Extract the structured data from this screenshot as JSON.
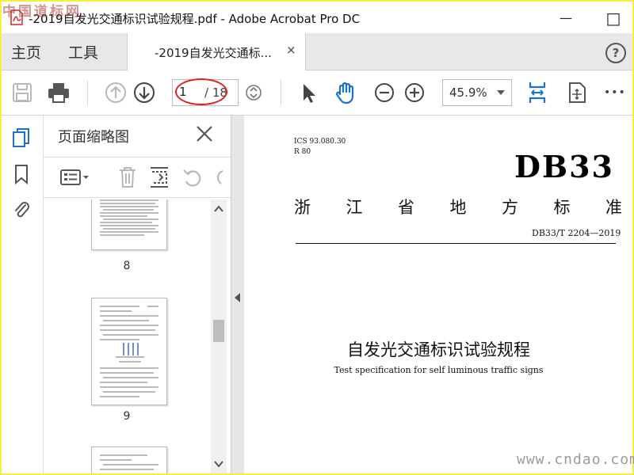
{
  "watermark": {
    "top": "中国道标网",
    "bottom": "www.cndao.com"
  },
  "window": {
    "title": "-2019自发光交通标识试验规程.pdf - Adobe Acrobat Pro DC",
    "minimize_glyph": "—",
    "maximize_glyph": "□"
  },
  "menu": {
    "home": "主页",
    "tools": "工具"
  },
  "tab": {
    "label": "-2019自发光交通标...",
    "close_glyph": "×"
  },
  "help": {
    "glyph": "?"
  },
  "toolbar": {
    "page_current": "1",
    "page_total": "/ 18",
    "zoom": "45.9%",
    "more_glyph": "•••"
  },
  "panel": {
    "title": "页面缩略图",
    "thumbnails": [
      {
        "label": "8"
      },
      {
        "label": "9"
      }
    ]
  },
  "document": {
    "ics": "ICS 93.080.30",
    "r_code": "R 80",
    "code": "DB33",
    "province_chars": [
      "浙",
      "江",
      "省",
      "地",
      "方",
      "标",
      "准"
    ],
    "std_no": "DB33/T 2204—2019",
    "title": "自发光交通标识试验规程",
    "subtitle": "Test specification for self luminous traffic signs"
  },
  "colors": {
    "frame_border": "#f6ef42",
    "annotation_red": "#e0201c",
    "accent_blue": "#1a73c8",
    "pdf_red": "#d4242a"
  }
}
